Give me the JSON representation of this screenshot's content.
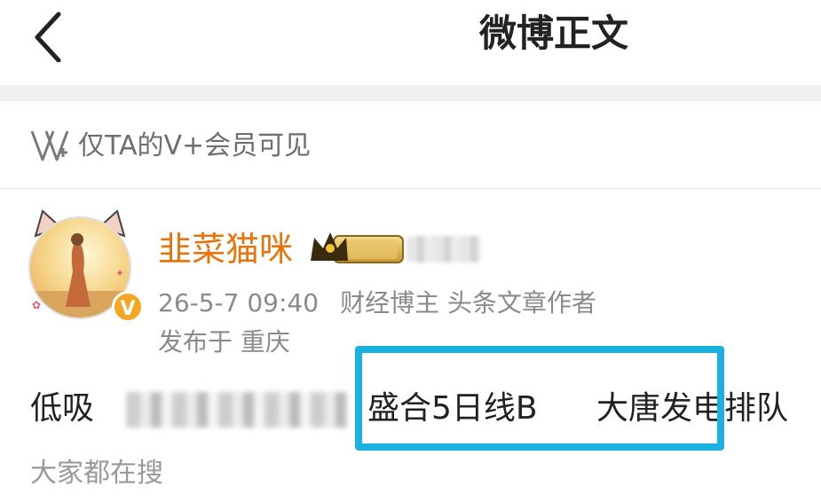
{
  "navbar": {
    "title": "微博正文"
  },
  "vplus": {
    "label": "仅TA的V+会员可见"
  },
  "post": {
    "author": {
      "name": "韭菜猫咪"
    },
    "timestamp": "26-5-7 09:40",
    "author_tags": "财经博主 头条文章作者",
    "location": "发布于 重庆",
    "content": {
      "prefix": "低吸",
      "tag_a": "盛合5日线B",
      "tag_b": "大唐发电排队"
    }
  },
  "search": {
    "label": "大家都在搜"
  },
  "colors": {
    "accent": "#e8740c",
    "highlight": "#1bb2e0"
  }
}
